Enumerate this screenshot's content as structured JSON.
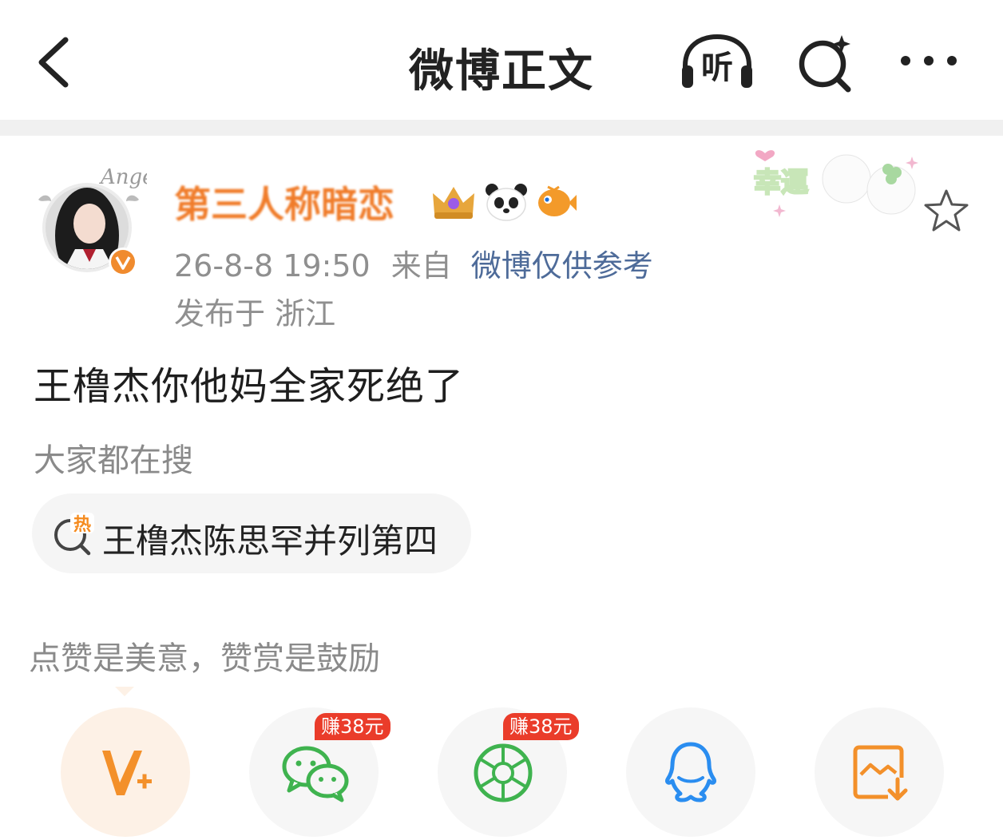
{
  "header": {
    "title": "微博正文",
    "listen_label": "听"
  },
  "post": {
    "author_name": "第三人称暗恋",
    "timestamp": "26-8-8 19:50",
    "from_prefix": "来自",
    "source": "微博仅供参考",
    "location": "发布于 浙江",
    "body": "王橹杰你他妈全家死绝了",
    "avatar_caption": "Angel",
    "sticker_text": "幸運"
  },
  "search": {
    "label": "大家都在搜",
    "hot_icon_text": "热",
    "hot_query": "王橹杰陈思罕并列第四"
  },
  "reward": {
    "text": "点赞是美意，赞赏是鼓励"
  },
  "share": {
    "wechat_badge": "赚38元",
    "moments_badge": "赚38元"
  },
  "colors": {
    "accent_orange": "#f07c2a",
    "link_blue": "#4e6b99",
    "wechat_green": "#3fb34f",
    "qq_blue": "#2a8df0",
    "badge_red": "#ea3c2a"
  },
  "icons": [
    "back-arrow-icon",
    "headphones-icon",
    "search-sparkle-icon",
    "more-dots-icon",
    "verified-v-icon",
    "crown-badge-icon",
    "panda-badge-icon",
    "fish-badge-icon",
    "star-icon",
    "hot-search-icon",
    "v-plus-icon",
    "wechat-icon",
    "moments-icon",
    "qq-icon",
    "save-image-icon"
  ]
}
